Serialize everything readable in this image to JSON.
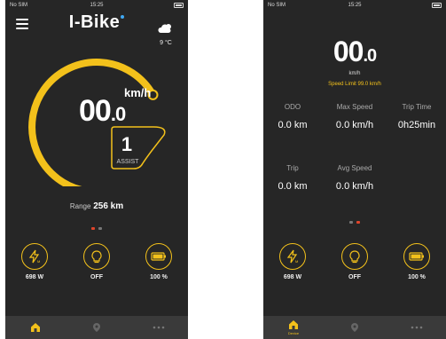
{
  "screen1": {
    "status": {
      "carrier": "No SIM",
      "time": "15:25"
    },
    "brand": "I-Bike",
    "weather": {
      "icon": "cloud-sun-icon",
      "temp": "9 °C"
    },
    "speed": {
      "int": "00",
      "dec": ".0",
      "unit": "km/h"
    },
    "speed_gauge_fraction": 0.72,
    "assist": {
      "level": "1",
      "label": "ASSIST"
    },
    "range": {
      "label": "Range",
      "value": "256 km"
    },
    "page_indicator": {
      "active": 0,
      "count": 2
    },
    "controls": [
      {
        "icon": "motor-power-icon",
        "value": "698 W"
      },
      {
        "icon": "headlight-icon",
        "value": "OFF"
      },
      {
        "icon": "battery-icon",
        "value": "100 %"
      }
    ],
    "tabs": [
      {
        "icon": "home-icon",
        "active": true
      },
      {
        "icon": "location-pin-icon",
        "active": false
      },
      {
        "icon": "more-icon",
        "active": false
      }
    ],
    "colors": {
      "accent": "#f3c11b",
      "background": "#262626",
      "tabbar": "#3a3a3a",
      "page_dot_active": "#e0452b"
    }
  },
  "screen2": {
    "status": {
      "carrier": "No SIM",
      "time": "15:25"
    },
    "speed": {
      "int": "00",
      "dec": ".0",
      "unit": "km/h"
    },
    "speed_limit": "Speed Limit 99.0 km/h",
    "stats": [
      {
        "label": "ODO",
        "value": "0.0 km"
      },
      {
        "label": "Max Speed",
        "value": "0.0 km/h"
      },
      {
        "label": "Trip Time",
        "value": "0h25min"
      },
      {
        "label": "Trip",
        "value": "0.0 km"
      },
      {
        "label": "Avg Speed",
        "value": "0.0 km/h"
      }
    ],
    "page_indicator": {
      "active": 1,
      "count": 2
    },
    "controls": [
      {
        "icon": "motor-power-icon",
        "value": "698 W"
      },
      {
        "icon": "headlight-icon",
        "value": "OFF"
      },
      {
        "icon": "battery-icon",
        "value": "100 %"
      }
    ],
    "tabs": [
      {
        "icon": "home-icon",
        "label": "Device",
        "active": true
      },
      {
        "icon": "location-pin-icon",
        "active": false
      },
      {
        "icon": "more-icon",
        "active": false
      }
    ]
  }
}
